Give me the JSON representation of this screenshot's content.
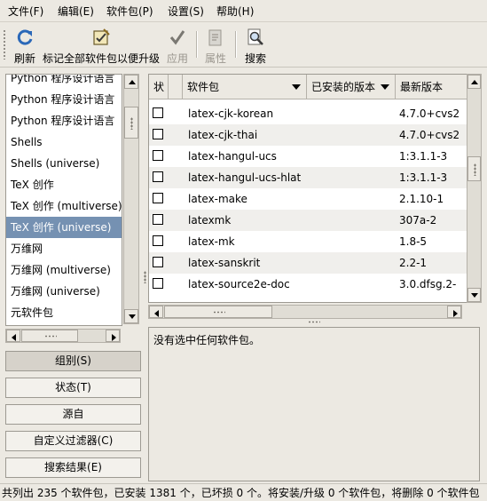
{
  "menubar": {
    "items": [
      "文件(F)",
      "编辑(E)",
      "软件包(P)",
      "设置(S)",
      "帮助(H)"
    ]
  },
  "toolbar": {
    "refresh": "刷新",
    "mark_upgrades": "标记全部软件包以便升级",
    "apply": "应用",
    "properties": "属性",
    "search": "搜索"
  },
  "sections": {
    "items": [
      "Python 程序设计语言",
      "Python 程序设计语言",
      "Python 程序设计语言",
      "Shells",
      "Shells (universe)",
      "TeX 创作",
      "TeX 创作 (multiverse)",
      "TeX 创作 (universe)",
      "万维网",
      "万维网 (multiverse)",
      "万维网 (universe)",
      "元软件包"
    ],
    "selected_index": 7
  },
  "filters": {
    "groups": "组别(S)",
    "status": "状态(T)",
    "origin": "源自",
    "custom": "自定义过滤器(C)",
    "search_results": "搜索结果(E)"
  },
  "table": {
    "headers": {
      "status": "状",
      "package": "软件包",
      "installed": "已安装的版本",
      "latest": "最新版本"
    },
    "rows": [
      {
        "name": "latex-cjk-korean",
        "installed": "",
        "latest": "4.7.0+cvs2"
      },
      {
        "name": "latex-cjk-thai",
        "installed": "",
        "latest": "4.7.0+cvs2"
      },
      {
        "name": "latex-hangul-ucs",
        "installed": "",
        "latest": "1:3.1.1-3"
      },
      {
        "name": "latex-hangul-ucs-hlat",
        "installed": "",
        "latest": "1:3.1.1-3"
      },
      {
        "name": "latex-make",
        "installed": "",
        "latest": "2.1.10-1"
      },
      {
        "name": "latexmk",
        "installed": "",
        "latest": "307a-2"
      },
      {
        "name": "latex-mk",
        "installed": "",
        "latest": "1.8-5"
      },
      {
        "name": "latex-sanskrit",
        "installed": "",
        "latest": "2.2-1"
      },
      {
        "name": "latex-source2e-doc",
        "installed": "",
        "latest": "3.0.dfsg.2-"
      }
    ]
  },
  "description": {
    "text": "没有选中任何软件包。"
  },
  "statusbar": {
    "text": "共列出 235 个软件包，已安装 1381 个，已坏损 0 个。将安装/升级 0 个软件包，将删除 0 个软件包"
  },
  "colors": {
    "selection": "#7591b2",
    "window_bg": "#ece9e2",
    "icon_blue": "#2a68b8"
  }
}
